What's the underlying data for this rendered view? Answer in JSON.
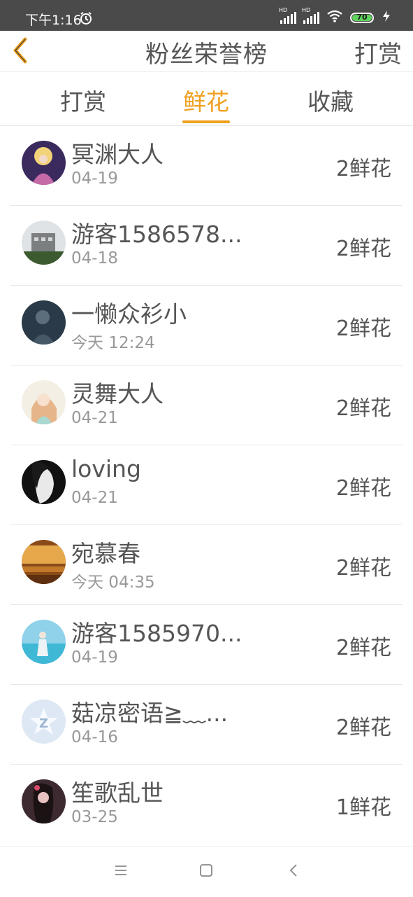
{
  "status_bar": {
    "time": "下午1:16",
    "battery_level": "70",
    "icons": [
      "alarm-icon",
      "signal-hd-icon",
      "signal-hd-icon",
      "wifi-icon",
      "battery-icon",
      "charging-icon"
    ]
  },
  "header": {
    "back_icon": "chevron-left-icon",
    "title": "粉丝荣誉榜",
    "right_action": "打赏"
  },
  "tabs": [
    {
      "label": "打赏",
      "active": false
    },
    {
      "label": "鲜花",
      "active": true
    },
    {
      "label": "收藏",
      "active": false
    }
  ],
  "list": [
    {
      "name": "冥渊大人",
      "date": "04-19",
      "count": "2鲜花"
    },
    {
      "name": "游客1586578...",
      "date": "04-18",
      "count": "2鲜花"
    },
    {
      "name": "一懒众衫小",
      "date": "今天 12:24",
      "count": "2鲜花"
    },
    {
      "name": "灵舞大人",
      "date": "04-21",
      "count": "2鲜花"
    },
    {
      "name": "loving",
      "date": "04-21",
      "count": "2鲜花"
    },
    {
      "name": "宛慕春",
      "date": "今天 04:35",
      "count": "2鲜花"
    },
    {
      "name": "游客1585970...",
      "date": "04-19",
      "count": "2鲜花"
    },
    {
      "name": "菇凉密语≧﹏...",
      "date": "04-16",
      "count": "2鲜花"
    },
    {
      "name": "笙歌乱世",
      "date": "03-25",
      "count": "1鲜花"
    }
  ],
  "colors": {
    "accent": "#f0a020",
    "status_bar": "#4a4a4a",
    "text": "#555555",
    "subtext": "#999999"
  },
  "nav_bar": {
    "icons": [
      "menu-icon",
      "home-square-icon",
      "back-triangle-icon"
    ]
  }
}
